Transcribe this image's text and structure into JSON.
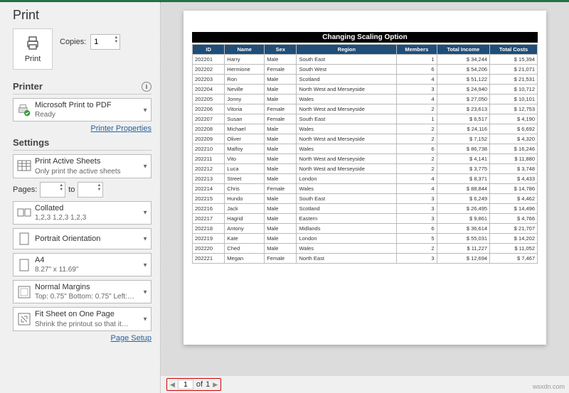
{
  "title": "Print",
  "print_button": "Print",
  "copies": {
    "label": "Copies:",
    "value": "1"
  },
  "printer": {
    "header": "Printer",
    "name": "Microsoft Print to PDF",
    "status": "Ready",
    "properties_link": "Printer Properties"
  },
  "settings": {
    "header": "Settings",
    "print_what": {
      "main": "Print Active Sheets",
      "sub": "Only print the active sheets"
    },
    "pages": {
      "label": "Pages:",
      "to": "to",
      "from": "",
      "to_val": ""
    },
    "collate": {
      "main": "Collated",
      "sub": "1,2,3    1,2,3    1,2,3"
    },
    "orientation": {
      "main": "Portrait Orientation",
      "sub": ""
    },
    "paper": {
      "main": "A4",
      "sub": "8.27\" x 11.69\""
    },
    "margins": {
      "main": "Normal Margins",
      "sub": "Top: 0.75\" Bottom: 0.75\" Left:…"
    },
    "scaling": {
      "main": "Fit Sheet on One Page",
      "sub": "Shrink the printout so that it…"
    },
    "page_setup_link": "Page Setup"
  },
  "preview": {
    "title": "Changing Scaling Option",
    "columns": [
      "ID",
      "Name",
      "Sex",
      "Region",
      "Members",
      "Total Income",
      "Total Costs"
    ],
    "rows": [
      [
        "202201",
        "Harry",
        "Male",
        "South East",
        "1",
        "$   34,244",
        "$   15,394"
      ],
      [
        "202202",
        "Hermione",
        "Female",
        "South West",
        "6",
        "$   54,206",
        "$   21,071"
      ],
      [
        "202203",
        "Ron",
        "Male",
        "Scotland",
        "4",
        "$   51,122",
        "$   21,531"
      ],
      [
        "202204",
        "Neville",
        "Male",
        "North West and Merseyside",
        "3",
        "$   24,940",
        "$   10,712"
      ],
      [
        "202205",
        "Jonny",
        "Male",
        "Wales",
        "4",
        "$   27,050",
        "$   10,101"
      ],
      [
        "202206",
        "Vitoria",
        "Female",
        "North West and Merseyside",
        "2",
        "$   23,613",
        "$   12,753"
      ],
      [
        "202207",
        "Susan",
        "Female",
        "South East",
        "1",
        "$     6,517",
        "$     4,190"
      ],
      [
        "202208",
        "Michael",
        "Male",
        "Wales",
        "2",
        "$   24,116",
        "$     6,692"
      ],
      [
        "202209",
        "Oliver",
        "Male",
        "North West and Merseyside",
        "2",
        "$     7,152",
        "$     4,320"
      ],
      [
        "202210",
        "Malfoy",
        "Male",
        "Wales",
        "6",
        "$   86,738",
        "$   16,246"
      ],
      [
        "202211",
        "Vito",
        "Male",
        "North West and Merseyside",
        "2",
        "$     4,141",
        "$   11,880"
      ],
      [
        "202212",
        "Luca",
        "Male",
        "North West and Merseyside",
        "2",
        "$     3,775",
        "$     3,748"
      ],
      [
        "202213",
        "Street",
        "Male",
        "London",
        "4",
        "$     8,371",
        "$     4,433"
      ],
      [
        "202214",
        "Chris",
        "Female",
        "Wales",
        "4",
        "$   88,844",
        "$   14,786"
      ],
      [
        "202215",
        "Hundo",
        "Male",
        "South East",
        "3",
        "$     6,249",
        "$     4,462"
      ],
      [
        "202216",
        "Jack",
        "Male",
        "Scotland",
        "3",
        "$   26,495",
        "$   14,496"
      ],
      [
        "202217",
        "Hagrid",
        "Male",
        "Eastern",
        "3",
        "$     9,861",
        "$     4,766"
      ],
      [
        "202218",
        "Antony",
        "Male",
        "Midlands",
        "6",
        "$   36,614",
        "$   21,707"
      ],
      [
        "202219",
        "Kate",
        "Male",
        "London",
        "5",
        "$   55,031",
        "$   14,202"
      ],
      [
        "202220",
        "Ched",
        "Male",
        "Wales",
        "2",
        "$   11,227",
        "$   11,052"
      ],
      [
        "202221",
        "Megan",
        "Female",
        "North East",
        "3",
        "$   12,694",
        "$     7,467"
      ]
    ]
  },
  "nav": {
    "current": "1",
    "of_label": "of",
    "total": "1"
  },
  "watermark": "wsxdn.com"
}
